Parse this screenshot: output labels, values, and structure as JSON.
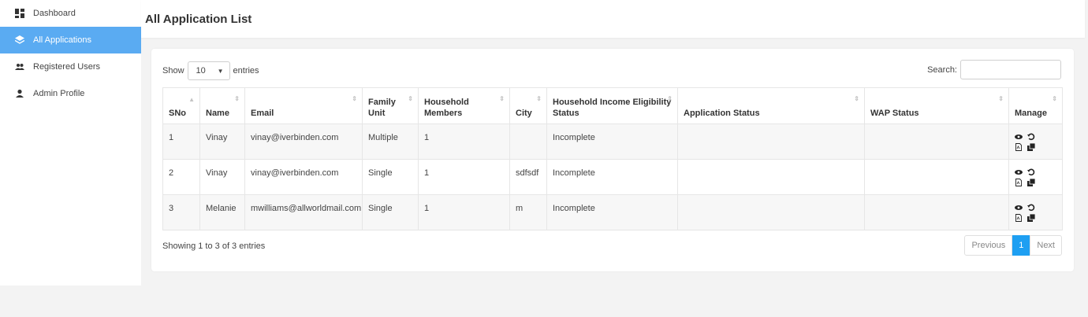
{
  "sidebar": {
    "items": [
      {
        "label": "Dashboard",
        "icon": "dashboard-icon"
      },
      {
        "label": "All Applications",
        "icon": "layers-icon",
        "active": true
      },
      {
        "label": "Registered Users",
        "icon": "users-icon"
      },
      {
        "label": "Admin Profile",
        "icon": "user-icon"
      }
    ]
  },
  "header": {
    "title": "All Application List"
  },
  "table_controls": {
    "show_label": "Show",
    "page_length": "10",
    "entries_label": "entries",
    "search_label": "Search:",
    "search_value": ""
  },
  "table": {
    "columns": [
      "SNo",
      "Name",
      "Email",
      "Family Unit",
      "Household Members",
      "City",
      "Household Income Eligibility Status",
      "Application Status",
      "WAP Status",
      "Manage"
    ],
    "rows": [
      {
        "sno": "1",
        "name": "Vinay",
        "email": "vinay@iverbinden.com",
        "family_unit": "Multiple",
        "household_members": "1",
        "city": "",
        "income_status": "Incomplete",
        "application_status": "",
        "wap_status": ""
      },
      {
        "sno": "2",
        "name": "Vinay",
        "email": "vinay@iverbinden.com",
        "family_unit": "Single",
        "household_members": "1",
        "city": "sdfsdf",
        "income_status": "Incomplete",
        "application_status": "",
        "wap_status": ""
      },
      {
        "sno": "3",
        "name": "Melanie",
        "email": "mwilliams@allworldmail.com",
        "family_unit": "Single",
        "household_members": "1",
        "city": "m",
        "income_status": "Incomplete",
        "application_status": "",
        "wap_status": ""
      }
    ],
    "manage_icons": [
      "eye-icon",
      "history-icon",
      "pdf-file-icon",
      "copy-icon"
    ]
  },
  "footer": {
    "info": "Showing 1 to 3 of 3 entries",
    "previous_label": "Previous",
    "current_page": "1",
    "next_label": "Next"
  },
  "colors": {
    "accent": "#5aabf2",
    "pagination_active": "#1e9ff2",
    "background": "#f3f3f3"
  }
}
